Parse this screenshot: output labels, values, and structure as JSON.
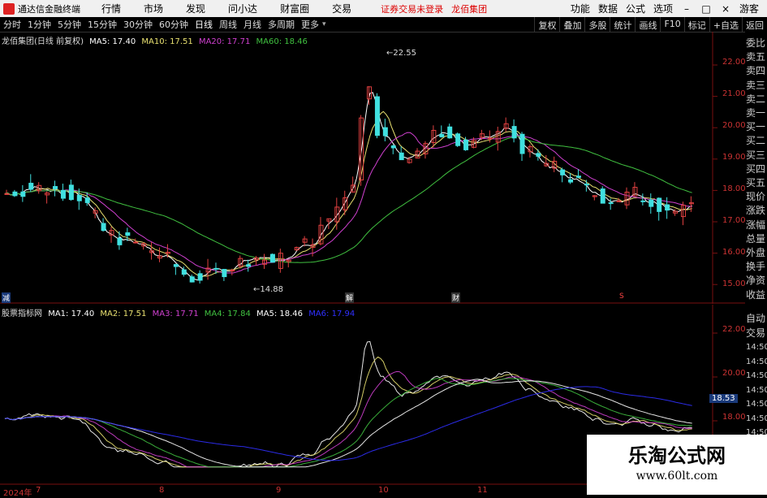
{
  "menu": {
    "app_name": "通达信金融终端",
    "items": [
      "行情",
      "市场",
      "发现",
      "问小达",
      "财富圈",
      "交易"
    ],
    "warning": "证券交易未登录",
    "stock_name": "龙佰集团",
    "right_items": [
      "功能",
      "数据",
      "公式",
      "选项"
    ],
    "guest": "游客"
  },
  "toolbar": {
    "periods": [
      "分时",
      "1分钟",
      "5分钟",
      "15分钟",
      "30分钟",
      "60分钟",
      "日线",
      "周线",
      "月线",
      "多周期",
      "更多"
    ],
    "right": [
      "复权",
      "叠加",
      "多股",
      "统计",
      "画线",
      "F10",
      "标记",
      "+自选",
      "返回"
    ]
  },
  "main_legend": {
    "title": "龙佰集团(日线 前复权)",
    "ma5": "MA5: 17.40",
    "ma10": "MA10: 17.51",
    "ma20": "MA20: 17.71",
    "ma60": "MA60: 18.46"
  },
  "sub_legend": {
    "title": "股票指标网",
    "ma1": "MA1: 17.40",
    "ma2": "MA2: 17.51",
    "ma3": "MA3: 17.71",
    "ma4": "MA4: 17.84",
    "ma5": "MA5: 18.46",
    "ma6": "MA6: 17.94"
  },
  "price_axis": [
    "22.00",
    "21.00",
    "20.00",
    "19.00",
    "18.00",
    "17.00",
    "16.00",
    "15.00"
  ],
  "sub_axis": [
    "22.00",
    "20.00",
    "18.00"
  ],
  "sub_current_box": "18.53",
  "annotations": {
    "high": "22.55",
    "low": "14.88"
  },
  "event_markers": [
    "解",
    "财"
  ],
  "x_axis": [
    "2024年",
    "7",
    "8",
    "9",
    "10",
    "11"
  ],
  "side_panel": [
    "委比",
    "卖五",
    "卖四",
    "卖三",
    "卖二",
    "卖一",
    "买一",
    "买二",
    "买三",
    "买四",
    "买五",
    "现价",
    "涨跌",
    "涨幅",
    "总量",
    "外盘",
    "换手",
    "净资",
    "收益"
  ],
  "side_panel_sub": [
    "自动",
    "交易",
    "14:50",
    "14:50",
    "14:50",
    "14:50",
    "14:50",
    "14:50",
    "14:50",
    "14:50"
  ],
  "watermark": {
    "title": "乐淘公式网",
    "url": "www.60lt.com"
  },
  "colors": {
    "up": "#e04040",
    "down": "#40e0e0",
    "ma5": "#ffffff",
    "ma10": "#e8e070",
    "ma20": "#d040d0",
    "ma60": "#40c040",
    "ma6": "#3030ff"
  }
}
